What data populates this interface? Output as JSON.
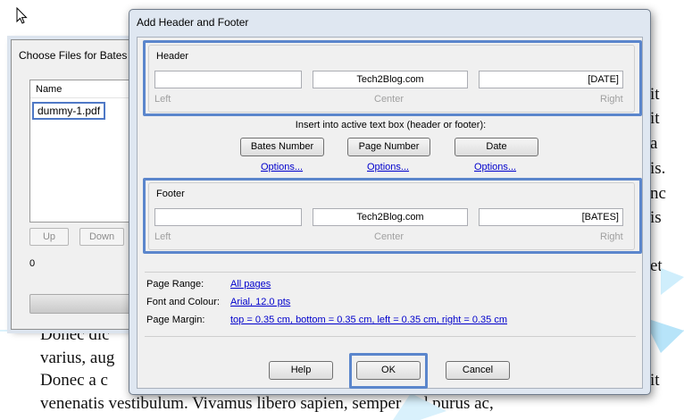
{
  "document": {
    "lines_right": [
      "it",
      "it",
      "a",
      "is.",
      "nc",
      "is",
      "et"
    ],
    "bottom_lines": [
      "Donec dic",
      "varius, aug",
      "Donec a c",
      "venenatis vestibulum. Vivamus libero sapien, semper sed purus ac,"
    ],
    "right_bottom": "it"
  },
  "back_dialog": {
    "title": "Choose Files for Bates I",
    "list_header": "Name",
    "file": "dummy-1.pdf",
    "up_label": "Up",
    "down_label": "Down",
    "count": "0"
  },
  "dialog": {
    "title": "Add Header and Footer",
    "header": {
      "label": "Header",
      "left_value": "",
      "center_value": "Tech2Blog.com",
      "right_value": "[DATE]",
      "left_hint": "Left",
      "center_hint": "Center",
      "right_hint": "Right"
    },
    "insert_label": "Insert into active text box (header or footer):",
    "buttons": {
      "bates": "Bates Number",
      "page": "Page Number",
      "date": "Date",
      "options": "Options..."
    },
    "footer": {
      "label": "Footer",
      "left_value": "",
      "center_value": "Tech2Blog.com",
      "right_value": "[BATES]",
      "left_hint": "Left",
      "center_hint": "Center",
      "right_hint": "Right"
    },
    "settings": {
      "page_range_label": "Page Range:",
      "page_range_value": "All pages",
      "font_label": "Font and Colour:",
      "font_value": "Arial, 12.0 pts",
      "margin_label": "Page Margin:",
      "margin_value": "top = 0.35 cm, bottom = 0.35 cm, left = 0.35 cm, right = 0.35 cm"
    },
    "footer_buttons": {
      "help": "Help",
      "ok": "OK",
      "cancel": "Cancel"
    }
  },
  "colors": {
    "highlight": "#5b86cc",
    "link": "#0000cc",
    "watermark": "#9fd8f5"
  }
}
